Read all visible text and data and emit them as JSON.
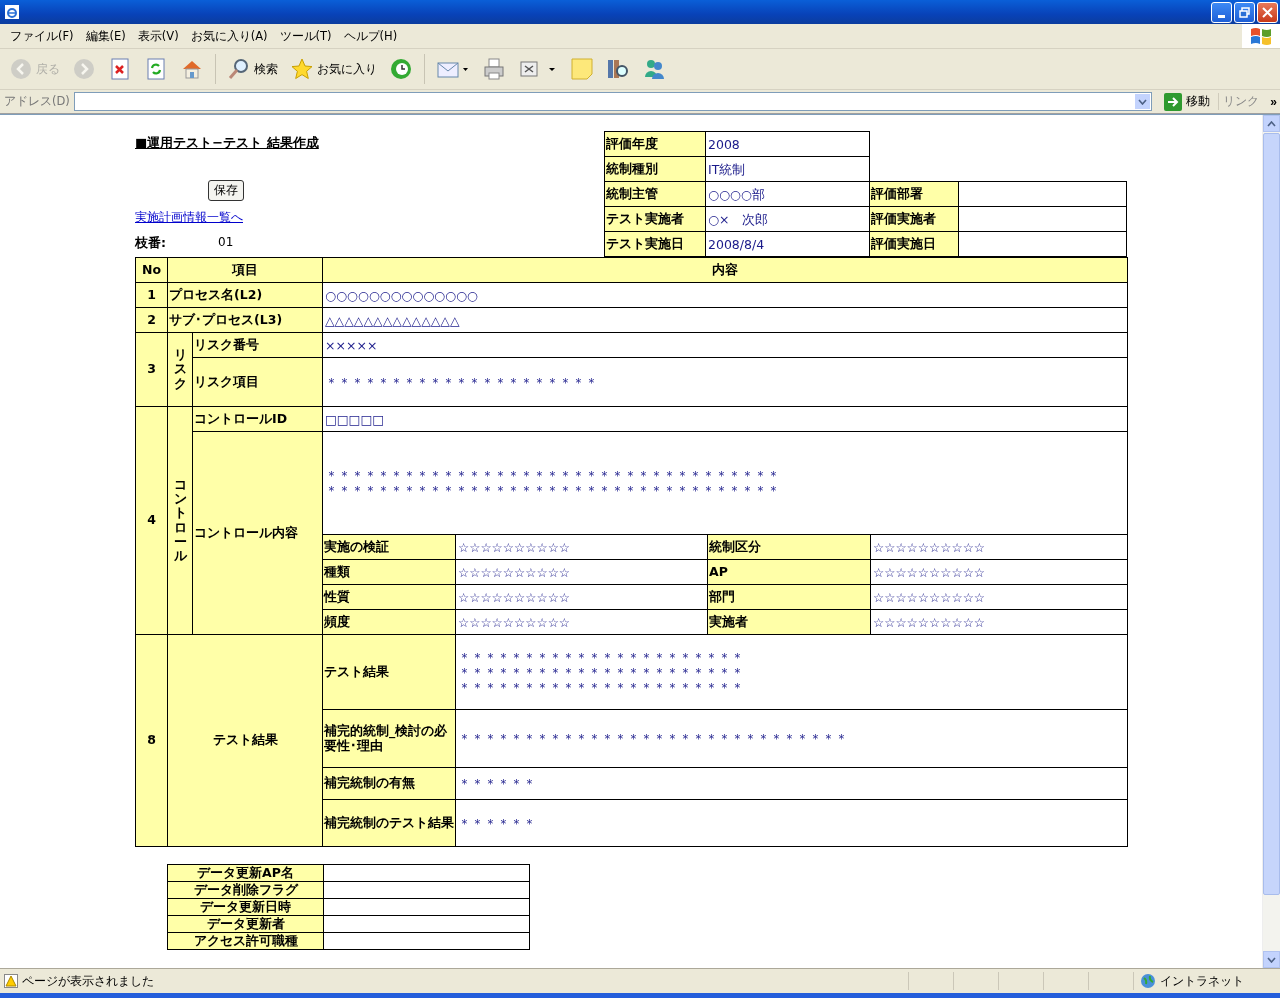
{
  "window": {
    "menu": [
      "ファイル(F)",
      "編集(E)",
      "表示(V)",
      "お気に入り(A)",
      "ツール(T)",
      "ヘルプ(H)"
    ],
    "toolbar": [
      {
        "kind": "back",
        "label": "戻る",
        "disabled": true
      },
      {
        "kind": "forward",
        "disabled": true
      },
      {
        "kind": "stop",
        "disabled": false
      },
      {
        "kind": "refresh",
        "disabled": false
      },
      {
        "kind": "home",
        "disabled": false
      },
      {
        "kind": "search",
        "label": "検索",
        "disabled": false
      },
      {
        "kind": "favorites",
        "label": "お気に入り",
        "disabled": false
      },
      {
        "kind": "history",
        "disabled": false
      },
      {
        "kind": "mail",
        "disabled": false
      },
      {
        "kind": "print",
        "disabled": false
      },
      {
        "kind": "edit",
        "disabled": false
      },
      {
        "kind": "note",
        "disabled": false
      },
      {
        "kind": "research",
        "disabled": false
      },
      {
        "kind": "messenger",
        "disabled": false
      }
    ],
    "address": {
      "label": "アドレス(D)",
      "go": "移動",
      "links": "リンク",
      "more": "»"
    },
    "status_bar": {
      "message": "ページが表示されました",
      "zone": "イントラネット"
    }
  },
  "page": {
    "title": "■運用テスト−テスト 結果作成",
    "save_button": "保存",
    "link": "実施計画情報一覧へ",
    "branch": {
      "label": "枝番:",
      "value": "01"
    },
    "info": [
      {
        "cells": [
          {
            "label": "評価年度",
            "value": "2008"
          }
        ]
      },
      {
        "cells": [
          {
            "label": "統制種別",
            "value": "IT統制"
          }
        ]
      },
      {
        "cells": [
          {
            "label": "統制主管",
            "value": "○○○○部"
          },
          {
            "label": "評価部署"
          }
        ]
      },
      {
        "cells": [
          {
            "label": "テスト実施者",
            "value": "○×　次郎"
          },
          {
            "label": "評価実施者"
          }
        ]
      },
      {
        "cells": [
          {
            "label": "テスト実施日",
            "value": "2008/8/4"
          },
          {
            "label": "評価実施日"
          }
        ]
      }
    ],
    "table": {
      "columns": [
        "No",
        "項目",
        "内容"
      ],
      "rows": [
        {
          "kind": "simple",
          "no": "1",
          "item": "プロセス名(L2)",
          "value": "○○○○○○○○○○○○○○"
        },
        {
          "kind": "simple",
          "no": "2",
          "item": "サブ･プロセス(L3)",
          "value": "△△△△△△△△△△△△△△"
        },
        {
          "kind": "group",
          "no": "3",
          "group": "リスク",
          "fields": [
            {
              "label": "リスク番号",
              "value": "×××××"
            },
            {
              "label": "リスク項目",
              "value": "＊＊＊＊＊＊＊＊＊＊＊＊＊＊＊＊＊＊＊＊＊"
            }
          ]
        },
        {
          "kind": "control",
          "no": "4",
          "group": "コントロール",
          "id_field": {
            "label": "コントロールID",
            "value": "□□□□□"
          },
          "content": {
            "label": "コントロール内容",
            "lines": [
              "＊＊＊＊＊＊＊＊＊＊＊＊＊＊＊＊＊＊＊＊＊＊＊＊＊＊＊＊＊＊＊＊＊＊＊",
              "＊＊＊＊＊＊＊＊＊＊＊＊＊＊＊＊＊＊＊＊＊＊＊＊＊＊＊＊＊＊＊＊＊＊＊"
            ],
            "attributes": [
              {
                "label": "実施の検証",
                "value": "☆☆☆☆☆☆☆☆☆☆"
              },
              {
                "label": "統制区分",
                "value": "☆☆☆☆☆☆☆☆☆☆"
              },
              {
                "label": "種類",
                "value": "☆☆☆☆☆☆☆☆☆☆"
              },
              {
                "label": "AP",
                "value": "☆☆☆☆☆☆☆☆☆☆"
              },
              {
                "label": "性質",
                "value": "☆☆☆☆☆☆☆☆☆☆"
              },
              {
                "label": "部門",
                "value": "☆☆☆☆☆☆☆☆☆☆"
              },
              {
                "label": "頻度",
                "value": "☆☆☆☆☆☆☆☆☆☆"
              },
              {
                "label": "実施者",
                "value": "☆☆☆☆☆☆☆☆☆☆"
              }
            ]
          }
        },
        {
          "kind": "result",
          "no": "8",
          "item": "テスト結果",
          "fields": [
            {
              "label": "テスト結果",
              "lines": [
                "＊＊＊＊＊＊＊＊＊＊＊＊＊＊＊＊＊＊＊＊＊＊",
                "＊＊＊＊＊＊＊＊＊＊＊＊＊＊＊＊＊＊＊＊＊＊",
                "＊＊＊＊＊＊＊＊＊＊＊＊＊＊＊＊＊＊＊＊＊＊"
              ]
            },
            {
              "label": "補完的統制_検討の必要性･理由",
              "lines": [
                "＊＊＊＊＊＊＊＊＊＊＊＊＊＊＊＊＊＊＊＊＊＊＊＊＊＊＊＊＊＊"
              ]
            },
            {
              "label": "補完統制の有無",
              "lines": [
                "＊＊＊＊＊＊"
              ]
            },
            {
              "label": "補完統制のテスト結果",
              "lines": [
                "＊＊＊＊＊＊"
              ]
            }
          ]
        }
      ]
    },
    "audit": [
      "データ更新AP名",
      "データ削除フラグ",
      "データ更新日時",
      "データ更新者",
      "アクセス許可職種"
    ]
  }
}
